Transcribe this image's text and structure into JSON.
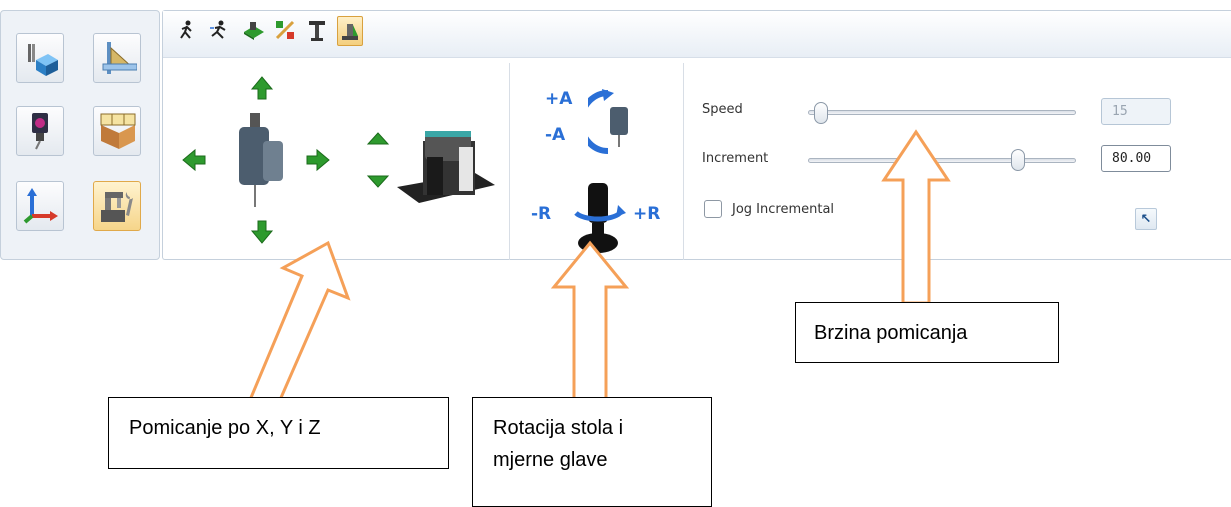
{
  "controls": {
    "speed_label": "Speed",
    "speed_value": "15",
    "increment_label": "Increment",
    "increment_value": "80.00",
    "jog_incremental_label": "Jog Incremental",
    "jog_incremental_checked": false,
    "speed_slider_level": 0.05,
    "increment_slider_level": 0.8
  },
  "rotation_labels": {
    "plus_a": "+A",
    "minus_a": "-A",
    "minus_r": "-R",
    "plus_r": "+R"
  },
  "annotations": {
    "xyz_movement": "Pomicanje po X, Y i Z",
    "rotation": "Rotacija stola i mjerne glave",
    "rotation_line1": "Rotacija stola i",
    "rotation_line2": "mjerne glave",
    "speed": "Brzina pomicanja"
  },
  "icons": {
    "toolbar": [
      "walk-slow-icon",
      "run-fast-icon",
      "table-plate-icon",
      "probe-toggle-icon",
      "column-probe-icon",
      "machine-view-icon"
    ],
    "palette": [
      "probe-cube-icon",
      "ruler-icon",
      "camera-probe-icon",
      "grid-box-icon",
      "axes-icon",
      "machine-settings-icon"
    ]
  },
  "colors": {
    "arrow_green": "#2e9a2e",
    "axis_blue": "#2a6fd6",
    "annotation_orange": "#f5a058",
    "active_yellow": "#f4cf7e"
  }
}
